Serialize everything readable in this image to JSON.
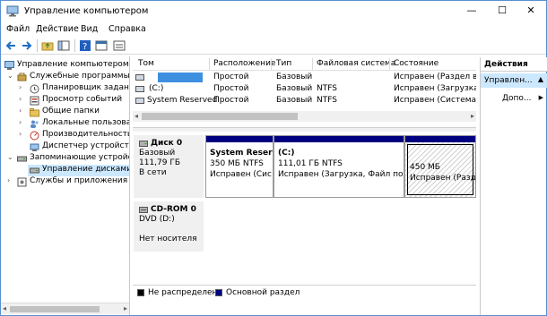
{
  "window": {
    "title": "Управление компьютером",
    "controls": {
      "minimize": "—",
      "maximize": "☐",
      "close": "✕"
    }
  },
  "menu": [
    "Файл",
    "Действие",
    "Вид",
    "Справка"
  ],
  "tree": [
    {
      "label": "Управление компьютером (л",
      "icon": "computer-management-icon",
      "twisty": ""
    },
    {
      "label": "Служебные программы",
      "icon": "tools-icon",
      "twisty": "⌄"
    },
    {
      "label": "Планировщик заданий",
      "icon": "clock-icon",
      "twisty": "›"
    },
    {
      "label": "Просмотр событий",
      "icon": "event-viewer-icon",
      "twisty": "›"
    },
    {
      "label": "Общие папки",
      "icon": "shared-folder-icon",
      "twisty": "›"
    },
    {
      "label": "Локальные пользовате",
      "icon": "users-icon",
      "twisty": "›"
    },
    {
      "label": "Производительность",
      "icon": "performance-icon",
      "twisty": "›"
    },
    {
      "label": "Диспетчер устройств",
      "icon": "device-manager-icon",
      "twisty": ""
    },
    {
      "label": "Запоминающие устройст",
      "icon": "storage-icon",
      "twisty": "⌄"
    },
    {
      "label": "Управление дисками",
      "icon": "disk-management-icon",
      "twisty": ""
    },
    {
      "label": "Службы и приложения",
      "icon": "services-icon",
      "twisty": "›"
    }
  ],
  "volumes": {
    "columns": [
      "Том",
      "Расположение",
      "Тип",
      "Файловая система",
      "Состояние"
    ],
    "rows": [
      {
        "volume": "",
        "layout": "Простой",
        "type": "Базовый",
        "fs": "",
        "status": "Исправен (Раздел вос"
      },
      {
        "volume": "(C:)",
        "layout": "Простой",
        "type": "Базовый",
        "fs": "NTFS",
        "status": "Исправен (Загрузка, Фа"
      },
      {
        "volume": "System Reserved",
        "layout": "Простой",
        "type": "Базовый",
        "fs": "NTFS",
        "status": "Исправен (Система, Ак"
      }
    ]
  },
  "disks": [
    {
      "name": "Диск 0",
      "kind": "Базовый",
      "size": "111,79 ГБ",
      "state": "В сети",
      "partitions": [
        {
          "name": "System Reserv",
          "size": "350 МБ NTFS",
          "status": "Исправен (Сис"
        },
        {
          "name": "(C:)",
          "size": "111,01 ГБ NTFS",
          "status": "Исправен (Загрузка, Файл подкач"
        },
        {
          "name": "",
          "size": "450 МБ",
          "status": "Исправен (Разде"
        }
      ]
    },
    {
      "name": "CD-ROM 0",
      "kind": "DVD (D:)",
      "size": "",
      "state": "Нет носителя",
      "partitions": []
    }
  ],
  "legend": [
    {
      "label": "Не распределена",
      "color": "#000000"
    },
    {
      "label": "Основной раздел",
      "color": "#000080"
    }
  ],
  "actions": {
    "header": "Действия",
    "selected": "Управлен...",
    "more": "Допо..."
  },
  "colors": {
    "primary_partition": "#000080",
    "selection": "#cce8ff",
    "window_border": "#5a8fd0"
  }
}
